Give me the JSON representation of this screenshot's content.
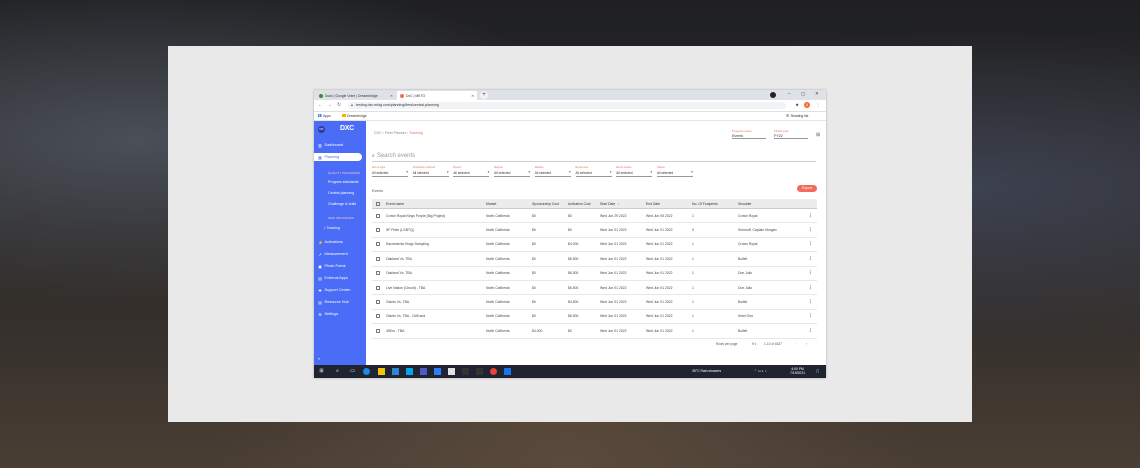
{
  "browser": {
    "tabs": [
      {
        "label": "Dock | Google Votre | Dreambridge"
      },
      {
        "label": "DxC | MKTG"
      }
    ],
    "url": "testing.dxc.mktg.com/planning/tiers/central-planning",
    "bookmarks": [
      {
        "label": "Apps"
      },
      {
        "label": "Dreambridge"
      }
    ],
    "reading_list": "Reading list",
    "profile_initial": "A"
  },
  "sidebar": {
    "avatar_initials": "DF",
    "logo": "DXC",
    "items": [
      {
        "label": "Dashboard",
        "icon": "dashboard-icon",
        "glyph": "▥"
      },
      {
        "label": "Planning",
        "icon": "calendar-icon",
        "glyph": "▦"
      }
    ],
    "section_quality": "QUALITY PROGRAMS",
    "quality_items": [
      "Program standards",
      "Central planning",
      "Challenge & build"
    ],
    "section_new": "NEW PROGRAMS",
    "new_items": [
      "Tracking"
    ],
    "bottom_items": [
      {
        "label": "Activations",
        "icon": "activation-icon",
        "glyph": "⚡"
      },
      {
        "label": "Measurement",
        "icon": "chart-icon",
        "glyph": "↗"
      },
      {
        "label": "Photo Portal",
        "icon": "photo-icon",
        "glyph": "▣"
      },
      {
        "label": "External Apps",
        "icon": "apps-icon",
        "glyph": "▤"
      },
      {
        "label": "Support Center",
        "icon": "support-icon",
        "glyph": "✚"
      },
      {
        "label": "Resource Hub",
        "icon": "hub-icon",
        "glyph": "▤"
      },
      {
        "label": "Settings",
        "icon": "gear-icon",
        "glyph": "⚙"
      }
    ],
    "collapse": "«"
  },
  "header": {
    "breadcrumb": [
      "DXC",
      "Fiest Planner"
    ],
    "breadcrumb_current": "Tracking",
    "selectors": [
      {
        "label": "Program name",
        "value": "Events"
      },
      {
        "label": "Fiscal year",
        "value": "FY22"
      }
    ]
  },
  "search": {
    "placeholder": "Search events"
  },
  "filters": [
    {
      "label": "Event type",
      "value": "All selected"
    },
    {
      "label": "Activation method",
      "value": "All selected"
    },
    {
      "label": "Brand",
      "value": "All selected"
    },
    {
      "label": "Region",
      "value": "All selected"
    },
    {
      "label": "Market",
      "value": "All selected"
    },
    {
      "label": "Enterprise",
      "value": "All selected"
    },
    {
      "label": "Event status",
      "value": "All selected"
    },
    {
      "label": "Status",
      "value": "All selected"
    }
  ],
  "events_label": "Events",
  "export_label": "Export",
  "table": {
    "columns": [
      "Event name",
      "Market",
      "Sponsorship Cost",
      "Activation Cost",
      "Start Date",
      "End Date",
      "No. Of Footprints",
      "Shoulder"
    ],
    "sort_indicator": "↓",
    "rows": [
      [
        "Crown Royal Kings Purple (Big Project)",
        "North California",
        "$0",
        "$0",
        "Wed Jun 29 2022",
        "Wed Jun 05 2022",
        "1",
        "Crown Royal"
      ],
      [
        "SF Pride (LGBTQ)",
        "North California",
        "$0",
        "$0",
        "Wed Jun 01 2022",
        "Wed Jun 01 2022",
        "3",
        "Smirnoff, Captain Morgan"
      ],
      [
        "Sacramento Kings Sampling",
        "North California",
        "$0",
        "$4,000",
        "Wed Jun 01 2022",
        "Wed Jun 01 2022",
        "1",
        "Crown Royal"
      ],
      [
        "Oakland Vs. TBA",
        "North California",
        "$0",
        "$6,500",
        "Wed Jun 01 2022",
        "Wed Jun 01 2022",
        "1",
        "Bulleit"
      ],
      [
        "Oakland Vs. TBA",
        "North California",
        "$0",
        "$6,500",
        "Wed Jun 01 2022",
        "Wed Jun 01 2022",
        "1",
        "Don Julio"
      ],
      [
        "Live Nation (Circuit) - TBA",
        "North California",
        "$0",
        "$6,500",
        "Wed Jun 01 2022",
        "Wed Jun 01 2022",
        "1",
        "Don Julio"
      ],
      [
        "Giants Vs. TBA",
        "North California",
        "$0",
        "$4,500",
        "Wed Jun 01 2022",
        "Wed Jun 01 2022",
        "1",
        "Bulleit"
      ],
      [
        "Giants Vs. TBA - 10/8 and",
        "North California",
        "$0",
        "$6,500",
        "Wed Jun 01 2022",
        "Wed Jun 01 2022",
        "1",
        "Ketel One"
      ],
      [
        "49Ers - TBA",
        "North California",
        "$4,000",
        "$0",
        "Wed Jun 01 2022",
        "Wed Jun 01 2022",
        "1",
        "Bulleit"
      ]
    ]
  },
  "pagination": {
    "rows_per_page_label": "Rows per page",
    "rows_per_page": "9",
    "range": "1-10 of 4627"
  },
  "taskbar": {
    "weather": "35°C  Rain showers",
    "time": "4:00 PM",
    "date": "7/19/2021"
  },
  "colors": {
    "accent": "#4a6cf7",
    "orange": "#f26b5b"
  }
}
